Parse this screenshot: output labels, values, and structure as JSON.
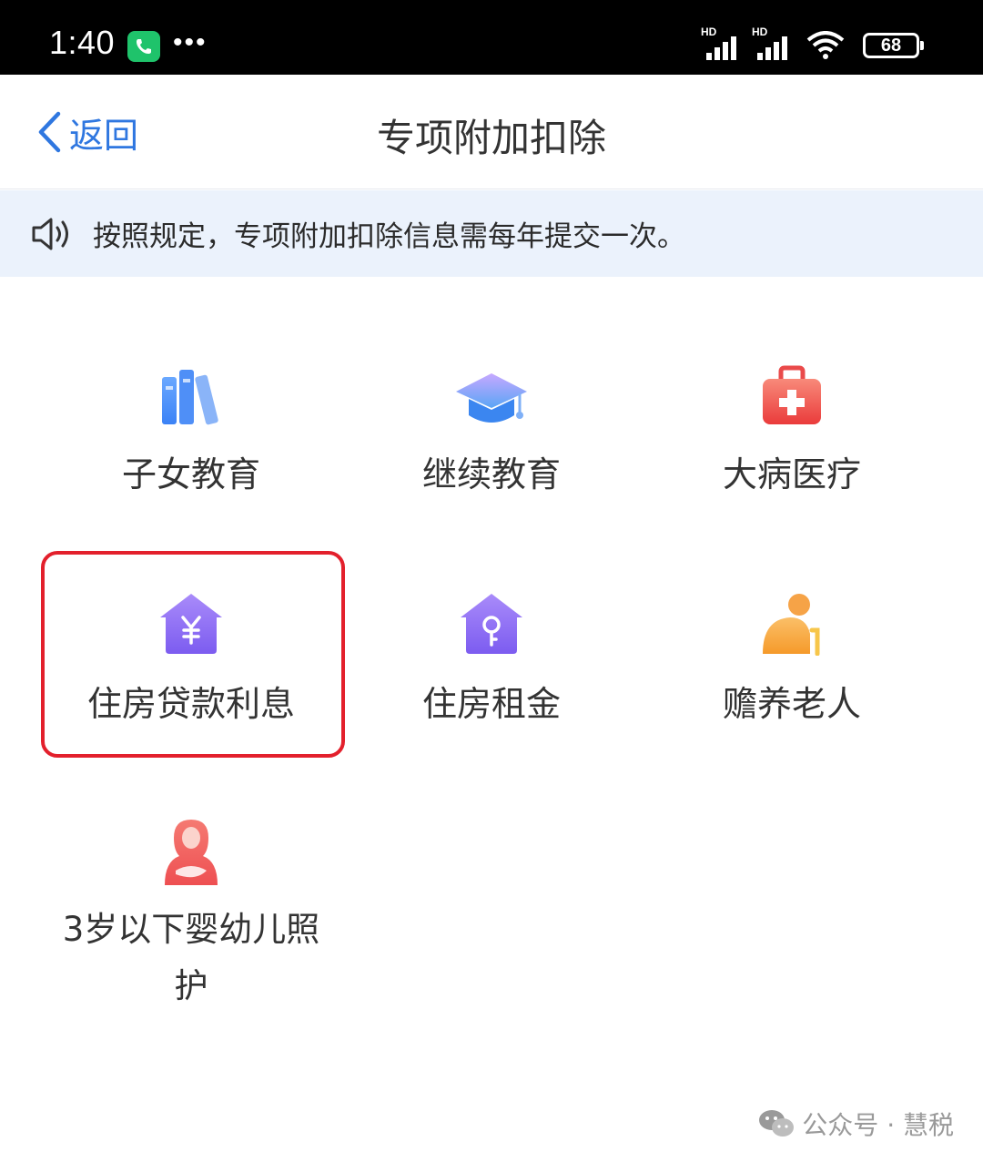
{
  "status_bar": {
    "time": "1:40",
    "more": "•••",
    "network_1": "HD",
    "network_2": "HD",
    "battery": "68"
  },
  "nav": {
    "back_label": "返回",
    "title": "专项附加扣除"
  },
  "notice": {
    "text": "按照规定，专项附加扣除信息需每年提交一次。"
  },
  "categories": [
    {
      "label": "子女教育",
      "icon": "books-icon"
    },
    {
      "label": "继续教育",
      "icon": "graduation-cap-icon"
    },
    {
      "label": "大病医疗",
      "icon": "medical-kit-icon"
    },
    {
      "label": "住房贷款利息",
      "icon": "house-yuan-icon",
      "highlighted": true
    },
    {
      "label": "住房租金",
      "icon": "house-key-icon"
    },
    {
      "label": "赡养老人",
      "icon": "elderly-icon"
    },
    {
      "label": "3岁以下婴幼儿照护",
      "icon": "mother-baby-icon"
    }
  ],
  "watermark": {
    "text": "公众号 · 慧税"
  },
  "colors": {
    "accent_blue": "#2f77e0",
    "notice_bg": "#ebf2fc",
    "highlight_red": "#e3202c",
    "purple": "#8b5cf6",
    "red": "#ef4a4a",
    "orange": "#f7a64a"
  }
}
